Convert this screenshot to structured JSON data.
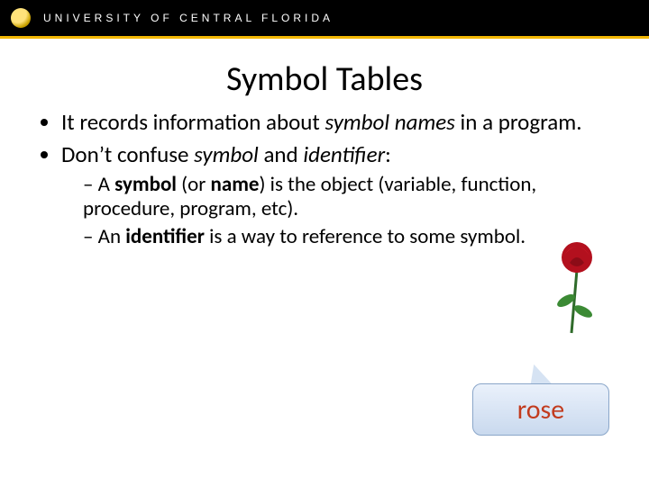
{
  "header": {
    "org_name": "UNIVERSITY OF CENTRAL FLORIDA"
  },
  "title": "Symbol Tables",
  "bullets": {
    "b1_pre": "It records information about ",
    "b1_em": "symbol names",
    "b1_post": " in a program.",
    "b2_pre": "Don’t confuse ",
    "b2_em1": "symbol",
    "b2_mid": " and ",
    "b2_em2": "identifier",
    "b2_post": ":",
    "s1_pre": "A ",
    "s1_b1": "symbol",
    "s1_mid1": " (or ",
    "s1_b2": "name",
    "s1_mid2": ") is the object (variable, function, procedure, program, etc).",
    "s2_pre": "An ",
    "s2_b1": "identifier",
    "s2_post": " is a way to reference to some symbol."
  },
  "callout": {
    "label": "rose"
  }
}
